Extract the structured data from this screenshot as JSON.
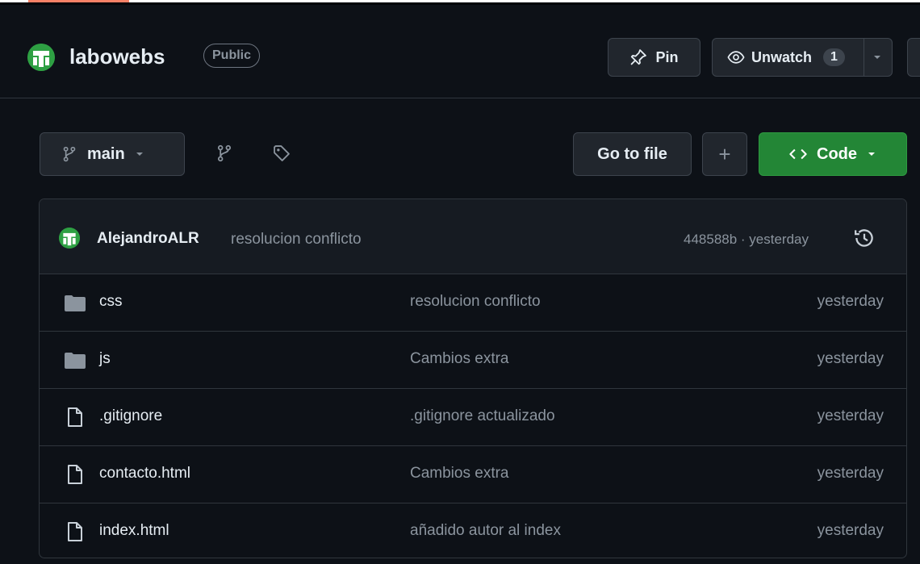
{
  "repo": {
    "name": "labowebs",
    "visibility": "Public",
    "pin_label": "Pin",
    "unwatch_label": "Unwatch",
    "watch_count": "1"
  },
  "toolbar": {
    "branch": "main",
    "goto_label": "Go to file",
    "plus_label": "+",
    "code_label": "Code"
  },
  "latest_commit": {
    "author": "AlejandroALR",
    "message": "resolucion conflicto",
    "meta": "448588b · yesterday"
  },
  "files": [
    {
      "type": "folder",
      "name": "css",
      "commit": "resolucion conflicto",
      "date": "yesterday"
    },
    {
      "type": "folder",
      "name": "js",
      "commit": "Cambios extra",
      "date": "yesterday"
    },
    {
      "type": "file",
      "name": ".gitignore",
      "commit": ".gitignore actualizado",
      "date": "yesterday"
    },
    {
      "type": "file",
      "name": "contacto.html",
      "commit": "Cambios extra",
      "date": "yesterday"
    },
    {
      "type": "file",
      "name": "index.html",
      "commit": "añadido autor al index",
      "date": "yesterday"
    }
  ],
  "colors": {
    "background": "#0d1117",
    "accent_green": "#238636",
    "border": "#30363d",
    "muted_text": "#8b949e"
  },
  "icons": {
    "repo_avatar": "avatar",
    "pin": "pin-icon",
    "unwatch": "eye-icon",
    "branch": "git-branch-icon",
    "branches": "git-branch-icon",
    "tags": "tag-icon",
    "code": "code-icon",
    "history": "history-icon",
    "folder": "folder-icon",
    "file": "file-icon"
  }
}
